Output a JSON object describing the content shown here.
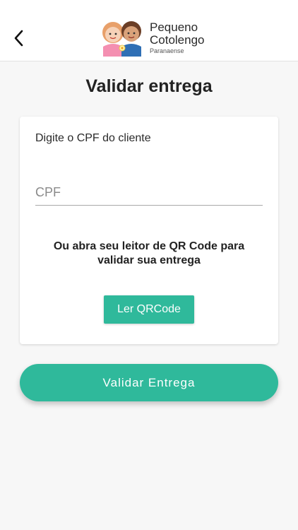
{
  "header": {
    "logo": {
      "line1": "Pequeno",
      "line2": "Cotolengo",
      "line3": "Paranaense"
    },
    "back_icon": "chevron-left-icon"
  },
  "page": {
    "title": "Validar entrega"
  },
  "card": {
    "label": "Digite o CPF do cliente",
    "cpf_placeholder": "CPF",
    "qr_instructions": "Ou abra seu leitor de QR Code para validar sua entrega",
    "qr_button_label": "Ler QRCode"
  },
  "actions": {
    "validate_label": "Validar Entrega"
  },
  "colors": {
    "accent": "#2fb99b",
    "background": "#f7f7f7"
  }
}
